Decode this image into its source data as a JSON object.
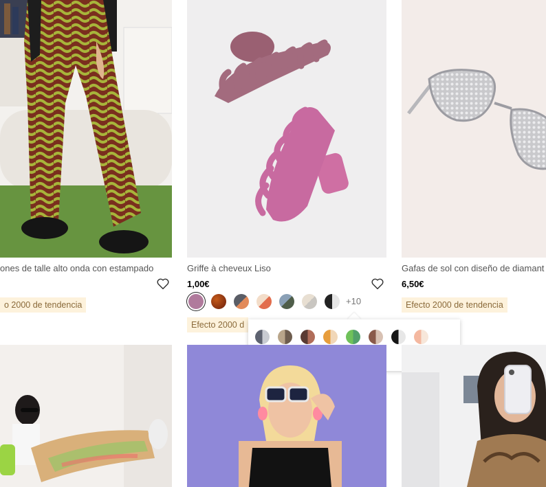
{
  "products": [
    {
      "title": "ones de talle alto onda con estampado",
      "tag": "o 2000 de tendencia"
    },
    {
      "title": "Griffe à cheveux Liso",
      "price": "1,00€",
      "more_colors": "+10",
      "tag": "Efecto 2000 d"
    },
    {
      "title": "Gafas de sol con diseño de diamant",
      "price": "6,50€",
      "tag": "Efecto 2000 de tendencia"
    }
  ],
  "colors": {
    "tag_bg": "#fdf2dc",
    "tag_text": "#8a6a3a",
    "selected_ring": "#222222"
  },
  "icons": {
    "wishlist": "heart-outline-icon"
  }
}
